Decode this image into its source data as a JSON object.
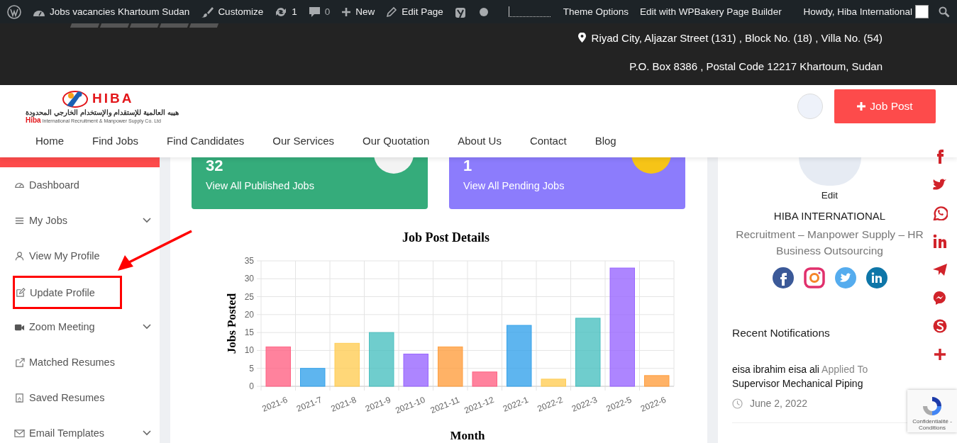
{
  "admin_bar": {
    "site": "Jobs vacancies Khartoum Sudan",
    "customize": "Customize",
    "updates": "1",
    "comments": "0",
    "new": "New",
    "edit_page": "Edit Page",
    "theme_options": "Theme Options",
    "page_builder": "Edit with WPBakery Page Builder",
    "greeting": "Howdy, Hiba International"
  },
  "top_bar": {
    "address_lines": [
      "Riyad City, Aljazar Street (131) , Block No. (18) , Villa No. (54)",
      "P.O. Box 8386 , Postal Code 12217 Khartoum, Sudan"
    ]
  },
  "header": {
    "logo": {
      "name": "HIBA",
      "arabic": "هيبه العالمية للإستقدام والإستخدام الخارجي المحدودة",
      "english_prefix": "Hiba",
      "english": "International Recruitment & Manpower Supply Co. Ltd"
    },
    "nav": [
      "Home",
      "Find Jobs",
      "Find Candidates",
      "Our Services",
      "Our Quotation",
      "About Us",
      "Contact",
      "Blog"
    ],
    "job_post_button": "Job Post"
  },
  "sidebar": {
    "items": [
      {
        "label": "Dashboard",
        "kind": "gauge",
        "expandable": false,
        "highlighted": false
      },
      {
        "label": "My Jobs",
        "kind": "list",
        "expandable": true,
        "highlighted": false
      },
      {
        "label": "View My Profile",
        "kind": "user",
        "expandable": false,
        "highlighted": false
      },
      {
        "label": "Update Profile",
        "kind": "edit",
        "expandable": false,
        "highlighted": true
      },
      {
        "label": "Zoom Meeting",
        "kind": "video",
        "expandable": true,
        "highlighted": false
      },
      {
        "label": "Matched Resumes",
        "kind": "external",
        "expandable": false,
        "highlighted": false
      },
      {
        "label": "Saved Resumes",
        "kind": "document",
        "expandable": false,
        "highlighted": false
      },
      {
        "label": "Email Templates",
        "kind": "mail",
        "expandable": true,
        "highlighted": false
      }
    ]
  },
  "stats": [
    {
      "count": "32",
      "label": "View All Published Jobs",
      "color": "#35ac7b"
    },
    {
      "count": "1",
      "label": "View All Pending Jobs",
      "color": "#8c7cfc"
    }
  ],
  "chart": {
    "chart_data": {
      "type": "bar",
      "title": "Job Post Details",
      "xlabel": "Month",
      "ylabel": "Jobs Posted",
      "categories": [
        "2021-6",
        "2021-7",
        "2021-8",
        "2021-9",
        "2021-10",
        "2021-11",
        "2021-12",
        "2022-1",
        "2022-2",
        "2022-3",
        "2022-5",
        "2022-6"
      ],
      "grid": true,
      "series": [
        {
          "colors": [
            "#ff6384",
            "#36a2eb",
            "#ffcd56",
            "#4bc0c0",
            "#9966ff",
            "#ff9f40",
            "#ff6384",
            "#36a2eb",
            "#ffcd56",
            "#4bc0c0",
            "#9966ff",
            "#ff9f40"
          ],
          "values": [
            11,
            5,
            12,
            15,
            9,
            11,
            4,
            17,
            2,
            19,
            33,
            3
          ]
        }
      ],
      "ylim": [
        0,
        35
      ],
      "yticks": [
        0,
        5,
        10,
        15,
        20,
        25,
        30,
        35
      ]
    }
  },
  "profile": {
    "edit": "Edit",
    "name": "HIBA INTERNATIONAL",
    "tagline": "Recruitment – Manpower Supply – HR Business Outsourcing"
  },
  "notifications": {
    "title": "Recent Notifications",
    "items": [
      {
        "name": "eisa ibrahim eisa ali",
        "action": "Applied To",
        "job": "Supervisor Mechanical Piping",
        "date": "June 2, 2022"
      }
    ]
  },
  "recaptcha": {
    "terms": "Confidentialité - Conditions"
  }
}
